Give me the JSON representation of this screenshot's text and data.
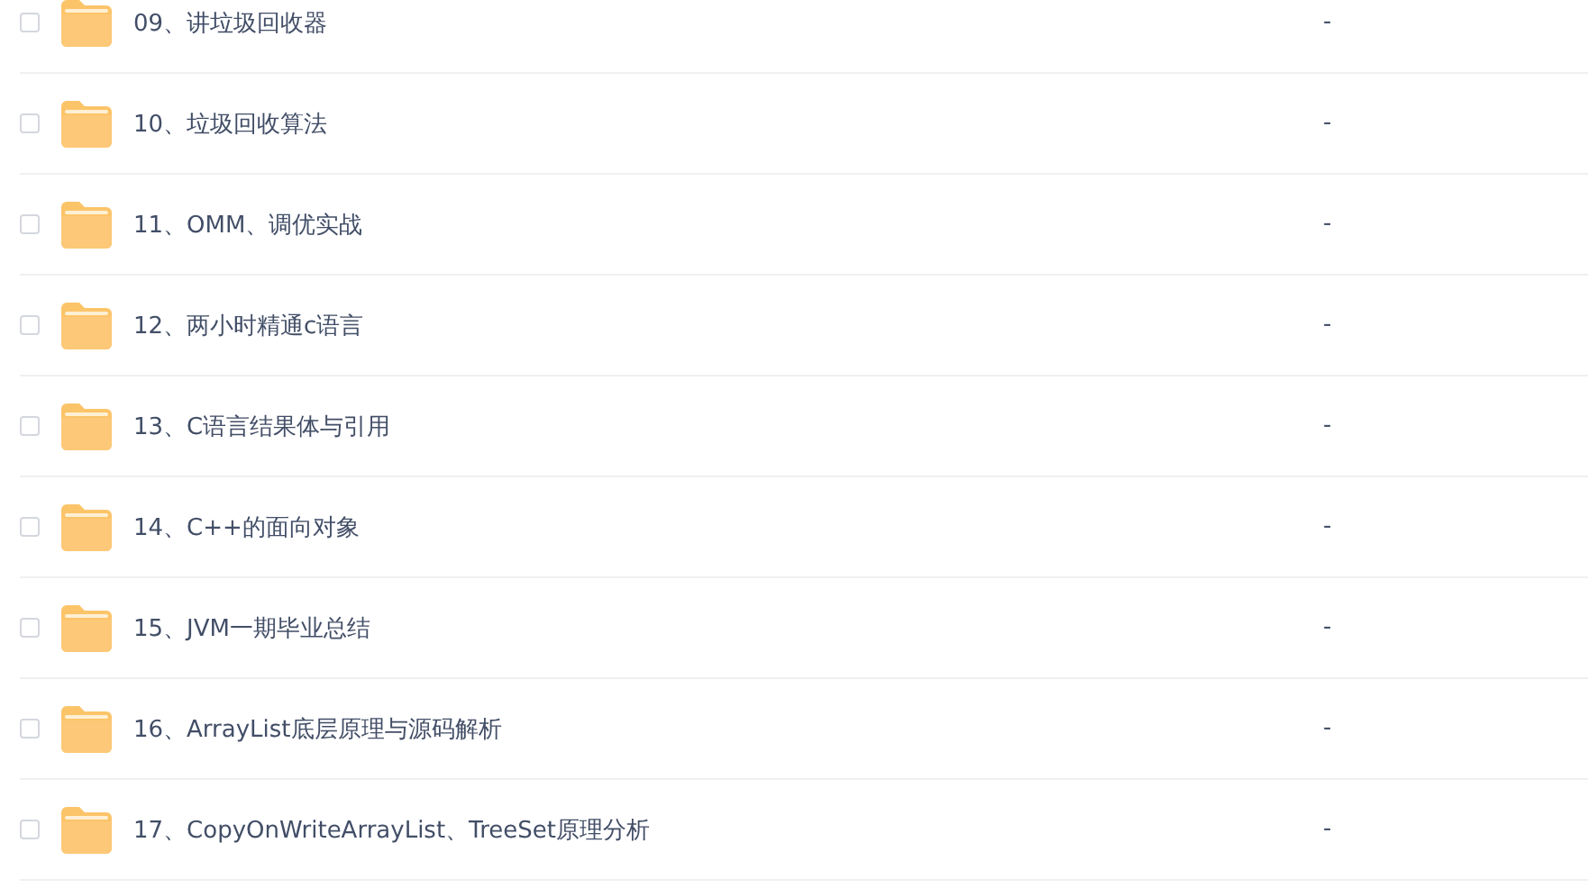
{
  "files": [
    {
      "name": "09、讲垃圾回收器",
      "checked": false,
      "size": "-"
    },
    {
      "name": "10、垃圾回收算法",
      "checked": false,
      "size": "-"
    },
    {
      "name": "11、OMM、调优实战",
      "checked": false,
      "size": "-"
    },
    {
      "name": "12、两小时精通c语言",
      "checked": false,
      "size": "-"
    },
    {
      "name": "13、C语言结果体与引用",
      "checked": false,
      "size": "-"
    },
    {
      "name": "14、C++的面向对象",
      "checked": false,
      "size": "-"
    },
    {
      "name": "15、JVM一期毕业总结",
      "checked": false,
      "size": "-"
    },
    {
      "name": "16、ArrayList底层原理与源码解析",
      "checked": false,
      "size": "-"
    },
    {
      "name": "17、CopyOnWriteArrayList、TreeSet原理分析",
      "checked": false,
      "size": "-"
    }
  ]
}
